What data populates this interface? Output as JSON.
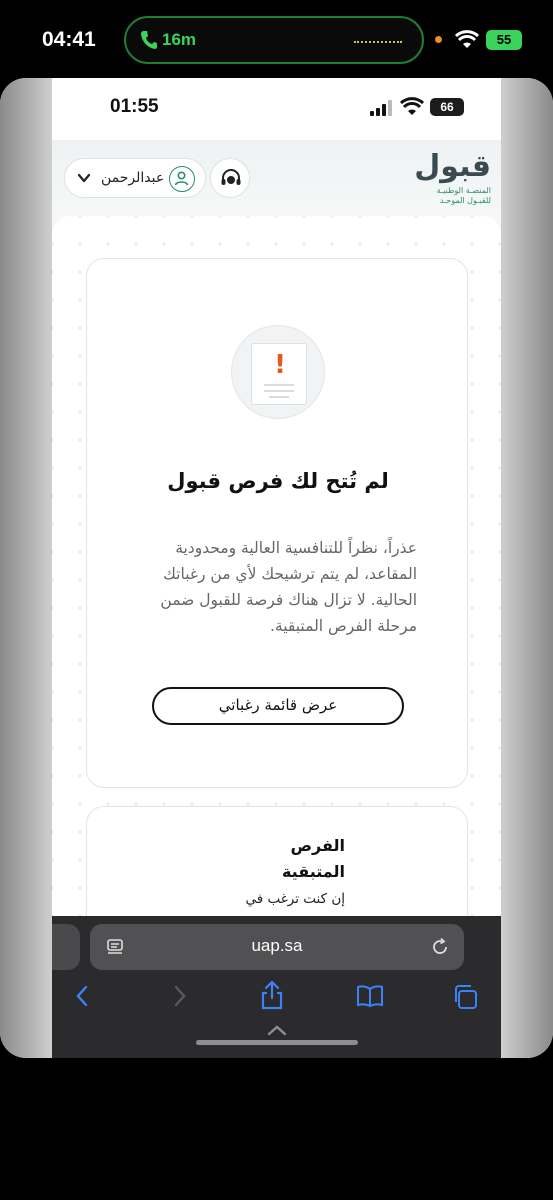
{
  "outer_status": {
    "time": "04:41",
    "call_duration": "16m",
    "battery": "55"
  },
  "inner_status": {
    "time": "01:55",
    "battery": "66"
  },
  "header": {
    "user_name": "عبدالرحمن",
    "logo_wordmark": "قبول",
    "logo_tagline_1": "المنصـة الوطنيـة",
    "logo_tagline_2": "للقبـول الموحـد"
  },
  "card": {
    "title": "لم تُتح لك فرص قبول",
    "body": "عذراً، نظراً للتنافسية العالية ومحدودية المقاعد، لم يتم ترشيحك لأي من رغباتك الحالية. لا تزال هناك فرصة للقبول ضمن مرحلة الفرص المتبقية.",
    "button_label": "عرض قائمة رغباتي"
  },
  "card2": {
    "title": "الفرص المتبقية",
    "text": "إن كنت ترغب في"
  },
  "browser": {
    "url": "uap.sa"
  },
  "colors": {
    "accent_green": "#2d8b6c",
    "alert_orange": "#e2581e",
    "call_green": "#3bd35a"
  }
}
